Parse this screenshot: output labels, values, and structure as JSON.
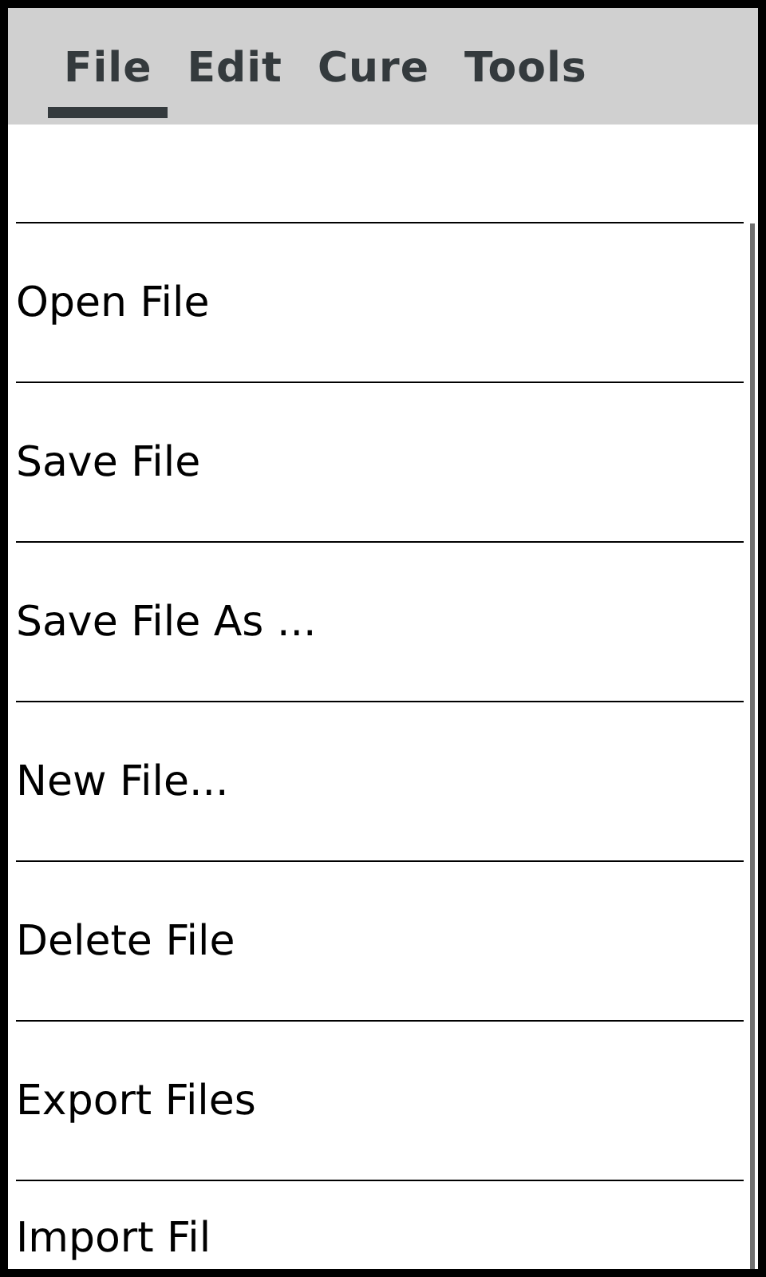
{
  "menu_bar": {
    "tabs": [
      {
        "label": "File",
        "selected": true
      },
      {
        "label": "Edit",
        "selected": false
      },
      {
        "label": "Cure",
        "selected": false
      },
      {
        "label": "Tools",
        "selected": false
      }
    ]
  },
  "file_menu": {
    "items": [
      "Open File",
      "Save File",
      "Save File As ...",
      "New File...",
      "Delete File",
      "Export Files",
      "Import Fil"
    ]
  }
}
